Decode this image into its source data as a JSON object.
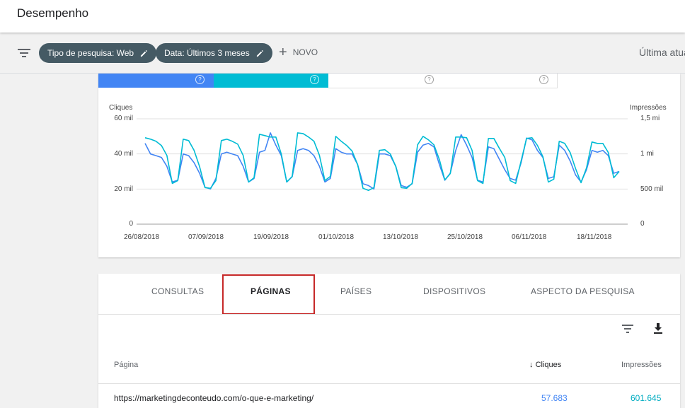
{
  "header": {
    "title": "Desempenho"
  },
  "filters": {
    "chips": [
      "Tipo de pesquisa: Web",
      "Data: Últimos 3 meses"
    ],
    "new_label": "NOVO",
    "right_text": "Última atua"
  },
  "colors": {
    "clicks": "#4285f4",
    "impressions": "#00bcd4",
    "chip_bg": "#455a64",
    "highlight": "#c62828"
  },
  "chart_data": {
    "type": "line",
    "left_axis_title": "Cliques",
    "right_axis_title": "Impressões",
    "left_ticks": [
      "60 mil",
      "40 mil",
      "20 mil",
      "0"
    ],
    "right_ticks": [
      "1,5 mi",
      "1 mi",
      "500 mil",
      "0"
    ],
    "left_ylim": [
      0,
      60000
    ],
    "right_ylim": [
      0,
      1500000
    ],
    "x_ticks": [
      "26/08/2018",
      "07/09/2018",
      "19/09/2018",
      "01/10/2018",
      "13/10/2018",
      "25/10/2018",
      "06/11/2018",
      "18/11/2018"
    ],
    "grid": true,
    "series": [
      {
        "name": "Cliques",
        "values": [
          46,
          40,
          39,
          38,
          33,
          24,
          25,
          40,
          39,
          35,
          29,
          21,
          20,
          26,
          40,
          41,
          40,
          39,
          33,
          24,
          26,
          41,
          42,
          52,
          45,
          39,
          24,
          27,
          42,
          43,
          42,
          39,
          33,
          24,
          26,
          43,
          41,
          40,
          40,
          34,
          23,
          22,
          20,
          40,
          40,
          39,
          33,
          22,
          21,
          23,
          41,
          45,
          46,
          44,
          34,
          25,
          29,
          42,
          51,
          45,
          38,
          25,
          24,
          44,
          43,
          37,
          31,
          26,
          25,
          35,
          49,
          48,
          42,
          38,
          26,
          27,
          45,
          42,
          36,
          28,
          24,
          31,
          42,
          41,
          42,
          39,
          29,
          30
        ]
      },
      {
        "name": "Impressões",
        "values": [
          1.23,
          1.21,
          1.18,
          1.12,
          0.98,
          0.58,
          0.62,
          1.21,
          1.19,
          1.05,
          0.82,
          0.52,
          0.51,
          0.62,
          1.19,
          1.21,
          1.18,
          1.14,
          0.98,
          0.6,
          0.66,
          1.28,
          1.26,
          1.24,
          1.24,
          1.0,
          0.6,
          0.68,
          1.3,
          1.29,
          1.24,
          1.18,
          0.98,
          0.62,
          0.68,
          1.25,
          1.18,
          1.12,
          1.04,
          0.85,
          0.51,
          0.48,
          0.52,
          1.05,
          1.06,
          1.0,
          0.82,
          0.52,
          0.51,
          0.58,
          1.13,
          1.25,
          1.2,
          1.13,
          0.92,
          0.63,
          0.72,
          1.24,
          1.24,
          1.23,
          1.05,
          0.62,
          0.58,
          1.22,
          1.22,
          1.08,
          0.95,
          0.62,
          0.58,
          0.9,
          1.22,
          1.23,
          1.12,
          0.96,
          0.6,
          0.64,
          1.18,
          1.15,
          1.02,
          0.79,
          0.59,
          0.8,
          1.17,
          1.15,
          1.15,
          1.02,
          0.66,
          0.75
        ]
      }
    ]
  },
  "tabs": [
    {
      "label": "CONSULTAS",
      "active": false
    },
    {
      "label": "PÁGINAS",
      "active": true
    },
    {
      "label": "PAÍSES",
      "active": false
    },
    {
      "label": "DISPOSITIVOS",
      "active": false
    },
    {
      "label": "ASPECTO DA PESQUISA",
      "active": false
    }
  ],
  "table": {
    "columns": {
      "page": "Página",
      "clicks": "Cliques",
      "impressions": "Impressões"
    },
    "sort_indicator": "↓",
    "rows": [
      {
        "page": "https://marketingdeconteudo.com/o-que-e-marketing/",
        "clicks": "57.683",
        "impressions": "601.645"
      }
    ]
  }
}
